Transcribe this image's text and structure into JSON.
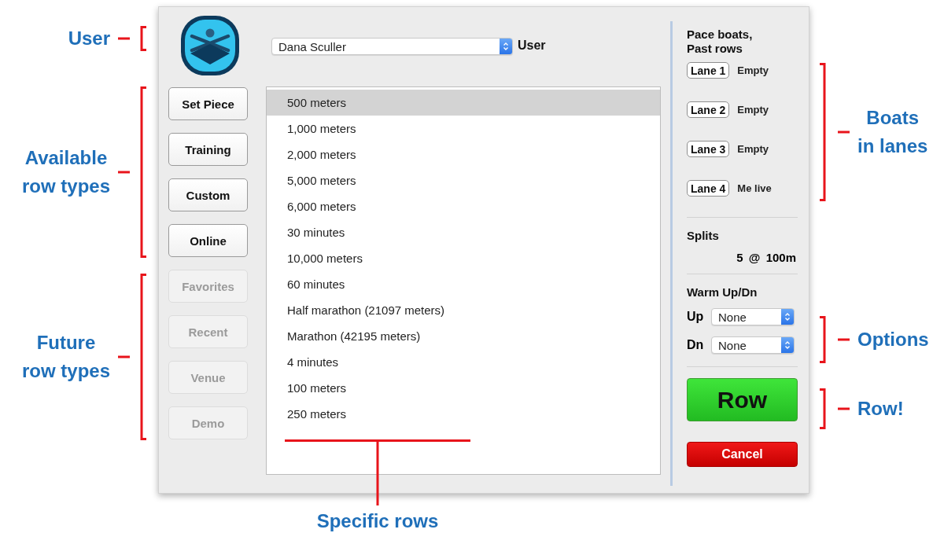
{
  "annotations": {
    "left": [
      {
        "label": "User"
      },
      {
        "label": "Available\nrow types"
      },
      {
        "label": "Future\nrow types"
      }
    ],
    "right": [
      {
        "label": "Boats\nin lanes"
      },
      {
        "label": "Options"
      },
      {
        "label": "Row!"
      }
    ],
    "bottom": [
      {
        "label": "Specific rows"
      }
    ]
  },
  "window": {
    "user_select": {
      "value": "Dana Sculler"
    },
    "user_label": "User",
    "row_types": [
      {
        "label": "Set Piece",
        "disabled": false
      },
      {
        "label": "Training",
        "disabled": false
      },
      {
        "label": "Custom",
        "disabled": false
      },
      {
        "label": "Online",
        "disabled": false
      },
      {
        "label": "Favorites",
        "disabled": true
      },
      {
        "label": "Recent",
        "disabled": true
      },
      {
        "label": "Venue",
        "disabled": true
      },
      {
        "label": "Demo",
        "disabled": true
      }
    ],
    "rows": [
      {
        "label": "500 meters",
        "selected": true
      },
      {
        "label": "1,000 meters",
        "selected": false
      },
      {
        "label": "2,000 meters",
        "selected": false
      },
      {
        "label": "5,000 meters",
        "selected": false
      },
      {
        "label": "6,000 meters",
        "selected": false
      },
      {
        "label": "30 minutes",
        "selected": false
      },
      {
        "label": "10,000 meters",
        "selected": false
      },
      {
        "label": "60 minutes",
        "selected": false
      },
      {
        "label": "Half marathon (21097 meters)",
        "selected": false
      },
      {
        "label": "Marathon (42195 meters)",
        "selected": false
      },
      {
        "label": "4 minutes",
        "selected": false
      },
      {
        "label": "100 meters",
        "selected": false
      },
      {
        "label": "250 meters",
        "selected": false
      }
    ],
    "sidebar": {
      "pace_heading": "Pace boats,\nPast rows",
      "lanes": [
        {
          "button": "Lane 1",
          "status": "Empty"
        },
        {
          "button": "Lane 2",
          "status": "Empty"
        },
        {
          "button": "Lane 3",
          "status": "Empty"
        },
        {
          "button": "Lane 4",
          "status": "Me live"
        }
      ],
      "splits_heading": "Splits",
      "splits_value": "5 @ 100m",
      "warmup_heading": "Warm Up/Dn",
      "warmup": [
        {
          "label": "Up",
          "value": "None"
        },
        {
          "label": "Dn",
          "value": "None"
        }
      ],
      "row_button": "Row",
      "cancel_button": "Cancel"
    }
  }
}
